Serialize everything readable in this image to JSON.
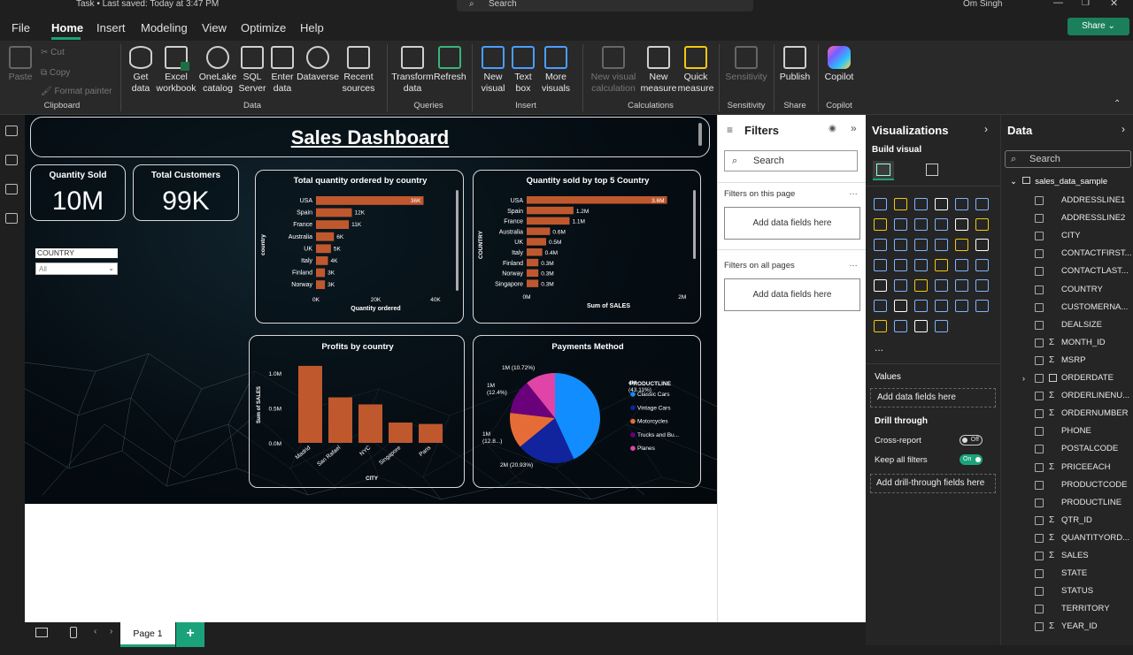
{
  "titlebar": {
    "title": "Task • Last saved: Today at 3:47 PM",
    "search": "Search",
    "user": "Om Singh"
  },
  "menu": {
    "tabs": [
      "File",
      "Home",
      "Insert",
      "Modeling",
      "View",
      "Optimize",
      "Help"
    ],
    "active": "Home",
    "share": "Share"
  },
  "ribbon": {
    "clipboard": {
      "paste": "Paste",
      "cut": "Cut",
      "copy": "Copy",
      "format": "Format painter",
      "group": "Clipboard"
    },
    "data": {
      "get": "Get data",
      "excel": "Excel workbook",
      "onelake": "OneLake catalog",
      "sql": "SQL Server",
      "enter": "Enter data",
      "dataverse": "Dataverse",
      "recent": "Recent sources",
      "group": "Data"
    },
    "queries": {
      "transform": "Transform data",
      "refresh": "Refresh",
      "group": "Queries"
    },
    "insert": {
      "newvisual": "New visual",
      "textbox": "Text box",
      "more": "More visuals",
      "group": "Insert"
    },
    "calc": {
      "newvc": "New visual calculation",
      "newmeasure": "New measure",
      "quick": "Quick measure",
      "group": "Calculations"
    },
    "sens": {
      "label": "Sensitivity",
      "group": "Sensitivity"
    },
    "share": {
      "publish": "Publish",
      "group": "Share"
    },
    "copilot": {
      "label": "Copilot",
      "group": "Copilot"
    }
  },
  "dashboard": {
    "title": "Sales Dashboard",
    "kpi1": {
      "label": "Quantity Sold",
      "value": "10M"
    },
    "kpi2": {
      "label": "Total Customers",
      "value": "99K"
    },
    "slicer": {
      "label": "COUNTRY",
      "value": "All"
    }
  },
  "chart_data": [
    {
      "type": "bar",
      "orientation": "horizontal",
      "title": "Total quantity ordered by country",
      "xlabel": "Quantity ordered",
      "ylabel": "country",
      "categories": [
        "USA",
        "Spain",
        "France",
        "Australia",
        "UK",
        "Italy",
        "Finland",
        "Norway"
      ],
      "values": [
        36000,
        12000,
        11000,
        6000,
        5000,
        4000,
        3000,
        3000
      ],
      "labels": [
        "36K",
        "12K",
        "11K",
        "6K",
        "5K",
        "4K",
        "3K",
        "3K"
      ],
      "xticks": [
        "0K",
        "20K",
        "40K"
      ],
      "xlim": [
        0,
        40000
      ],
      "color": "#c0582e"
    },
    {
      "type": "bar",
      "orientation": "horizontal",
      "title": "Quantity sold by top 5 Country",
      "xlabel": "Sum of SALES",
      "ylabel": "COUNTRY",
      "categories": [
        "USA",
        "Spain",
        "France",
        "Australia",
        "UK",
        "Italy",
        "Finland",
        "Norway",
        "Singapore"
      ],
      "values": [
        3.6,
        1.2,
        1.1,
        0.6,
        0.5,
        0.4,
        0.3,
        0.3,
        0.3
      ],
      "labels": [
        "3.6M",
        "1.2M",
        "1.1M",
        "0.6M",
        "0.5M",
        "0.4M",
        "0.3M",
        "0.3M",
        "0.3M"
      ],
      "xticks": [
        "0M",
        "2M"
      ],
      "xlim": [
        0,
        4.2
      ],
      "color": "#c0582e"
    },
    {
      "type": "bar",
      "title": "Profits by country",
      "xlabel": "CITY",
      "ylabel": "Sum of SALES",
      "categories": [
        "Madrid",
        "San Rafael",
        "NYC",
        "Singapore",
        "Paris"
      ],
      "values": [
        1.1,
        0.65,
        0.55,
        0.29,
        0.27
      ],
      "yticks": [
        "0.0M",
        "0.5M",
        "1.0M"
      ],
      "ylim": [
        0,
        1.2
      ],
      "color": "#c0582e"
    },
    {
      "type": "pie",
      "title": "Payments Method",
      "legend_title": "PRODUCTLINE",
      "slices": [
        {
          "name": "Classic Cars",
          "value": 43.11,
          "label": "4M\n(43.11%)",
          "color": "#118dff"
        },
        {
          "name": "Vintage Cars",
          "value": 20.93,
          "label": "2M (20.93%)",
          "color": "#12239e"
        },
        {
          "name": "Motorcycles",
          "value": 12.8,
          "label": "1M\n(12.8...)",
          "color": "#e66c37"
        },
        {
          "name": "Trucks and Bu...",
          "value": 12.4,
          "label": "1M\n(12.4%)",
          "color": "#6b007b"
        },
        {
          "name": "Planes",
          "value": 10.72,
          "label": "1M (10.72%)",
          "color": "#e044a7"
        }
      ]
    }
  ],
  "filters": {
    "title": "Filters",
    "search": "Search",
    "onpage": "Filters on this page",
    "allpages": "Filters on all pages",
    "add": "Add data fields here"
  },
  "viz": {
    "title": "Visualizations",
    "build": "Build visual",
    "values": "Values",
    "add": "Add data fields here",
    "drill": "Drill through",
    "cross": "Cross-report",
    "cross_state": "Off",
    "keep": "Keep all filters",
    "keep_state": "On",
    "adddrill": "Add drill-through fields here",
    "more": "..."
  },
  "data": {
    "title": "Data",
    "search": "Search",
    "table": "sales_data_sample",
    "fields": [
      {
        "name": "ADDRESSLINE1",
        "sigma": false
      },
      {
        "name": "ADDRESSLINE2",
        "sigma": false
      },
      {
        "name": "CITY",
        "sigma": false
      },
      {
        "name": "CONTACTFIRST...",
        "sigma": false
      },
      {
        "name": "CONTACTLAST...",
        "sigma": false
      },
      {
        "name": "COUNTRY",
        "sigma": false
      },
      {
        "name": "CUSTOMERNA...",
        "sigma": false
      },
      {
        "name": "DEALSIZE",
        "sigma": false
      },
      {
        "name": "MONTH_ID",
        "sigma": true
      },
      {
        "name": "MSRP",
        "sigma": true
      },
      {
        "name": "ORDERDATE",
        "sigma": false
      },
      {
        "name": "ORDERLINENU...",
        "sigma": true
      },
      {
        "name": "ORDERNUMBER",
        "sigma": true
      },
      {
        "name": "PHONE",
        "sigma": false
      },
      {
        "name": "POSTALCODE",
        "sigma": false
      },
      {
        "name": "PRICEEACH",
        "sigma": true
      },
      {
        "name": "PRODUCTCODE",
        "sigma": false
      },
      {
        "name": "PRODUCTLINE",
        "sigma": false
      },
      {
        "name": "QTR_ID",
        "sigma": true
      },
      {
        "name": "QUANTITYORD...",
        "sigma": true
      },
      {
        "name": "SALES",
        "sigma": true
      },
      {
        "name": "STATE",
        "sigma": false
      },
      {
        "name": "STATUS",
        "sigma": false
      },
      {
        "name": "TERRITORY",
        "sigma": false
      },
      {
        "name": "YEAR_ID",
        "sigma": true
      }
    ]
  },
  "pages": {
    "page1": "Page 1",
    "add": "+"
  }
}
